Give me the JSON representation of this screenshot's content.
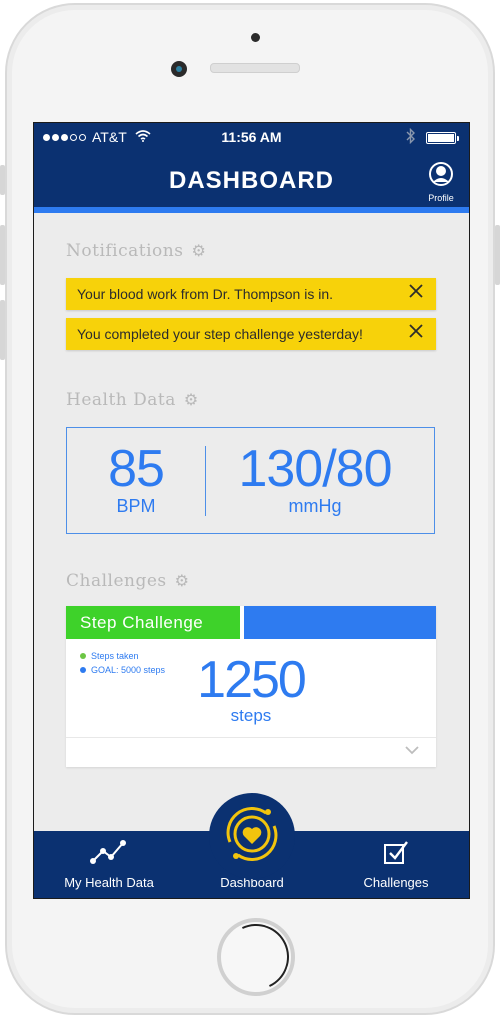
{
  "status_bar": {
    "carrier": "AT&T",
    "time": "11:56 AM"
  },
  "header": {
    "title": "DASHBOARD",
    "profile_label": "Profile"
  },
  "notifications": {
    "title": "Notifications",
    "items": [
      {
        "text": "Your blood work from Dr. Thompson is in."
      },
      {
        "text": "You completed your step challenge yesterday!"
      }
    ]
  },
  "health_data": {
    "title": "Health Data",
    "heart_rate": {
      "value": "85",
      "unit": "BPM"
    },
    "blood_pressure": {
      "value": "130/80",
      "unit": "mmHg"
    }
  },
  "challenges": {
    "title": "Challenges",
    "card": {
      "name": "Step Challenge",
      "legend": [
        {
          "label": "Steps taken",
          "color": "#6cc644"
        },
        {
          "label": "GOAL: 5000 steps",
          "color": "#2e7bf0"
        }
      ],
      "value": "1250",
      "unit": "steps"
    }
  },
  "nav": {
    "items": [
      {
        "label": "My Health Data"
      },
      {
        "label": "Dashboard"
      },
      {
        "label": "Challenges"
      }
    ]
  },
  "colors": {
    "primary": "#0b3171",
    "accent": "#2e7bf0",
    "notice": "#f7d20a",
    "progress": "#3ed22a",
    "brand_icon": "#f2c40d"
  }
}
